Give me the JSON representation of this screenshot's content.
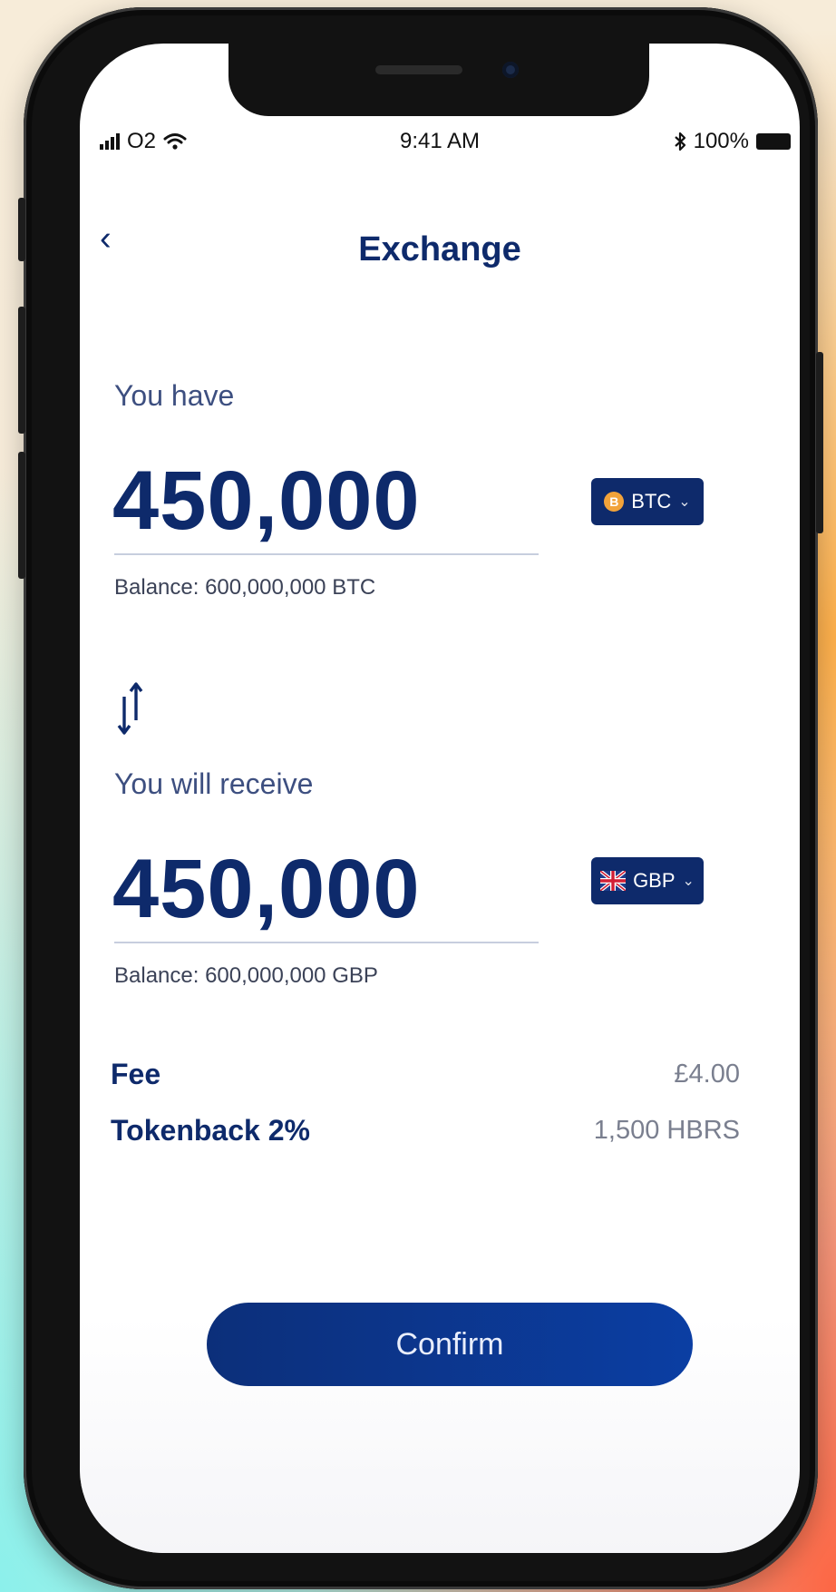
{
  "status_bar": {
    "carrier": "O2",
    "time": "9:41 AM",
    "battery": "100%"
  },
  "header": {
    "back_glyph": "‹",
    "title": "Exchange"
  },
  "from": {
    "label": "You have",
    "amount": "450,000",
    "currency": "BTC",
    "currency_icon": "B",
    "balance": "Balance: 600,000,000 BTC"
  },
  "to": {
    "label": "You will receive",
    "amount": "450,000",
    "currency": "GBP",
    "balance": "Balance: 600,000,000 GBP"
  },
  "fees": {
    "fee_label": "Fee",
    "fee_value": "£4.00",
    "tokenback_label": "Tokenback 2%",
    "tokenback_value": "1,500 HBRS"
  },
  "confirm_label": "Confirm",
  "colors": {
    "primary": "#0e2a6b",
    "button": "#0b3ea3",
    "btc": "#f2a33a"
  }
}
